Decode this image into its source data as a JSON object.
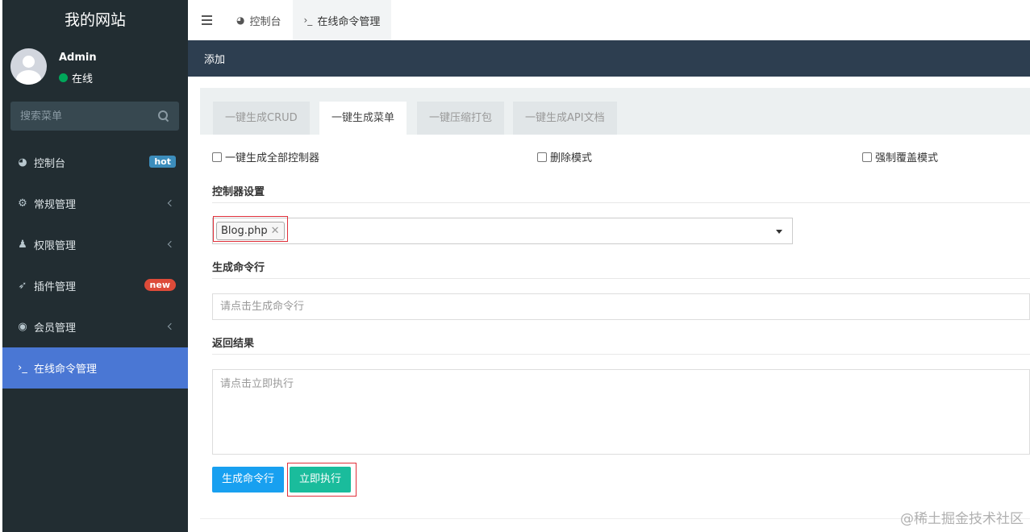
{
  "sidebar": {
    "brand": "我的网站",
    "user": {
      "name": "Admin",
      "status": "在线"
    },
    "search_placeholder": "搜索菜单",
    "items": [
      {
        "label": "控制台",
        "icon": "dashboard-icon",
        "badge": "hot"
      },
      {
        "label": "常规管理",
        "icon": "cogs-icon"
      },
      {
        "label": "权限管理",
        "icon": "group-icon"
      },
      {
        "label": "插件管理",
        "icon": "rocket-icon",
        "badge": "new"
      },
      {
        "label": "会员管理",
        "icon": "user-circle-icon"
      },
      {
        "label": "在线命令管理",
        "icon": "terminal-icon",
        "active": true
      }
    ]
  },
  "navbar": {
    "tabs": [
      {
        "label": "控制台",
        "icon": "dashboard-icon"
      },
      {
        "label": "在线命令管理",
        "icon": "terminal-icon",
        "active": true
      }
    ]
  },
  "header": {
    "title": "添加"
  },
  "content": {
    "tabs": [
      {
        "label": "一键生成CRUD"
      },
      {
        "label": "一键生成菜单",
        "active": true
      },
      {
        "label": "一键压缩打包"
      },
      {
        "label": "一键生成API文档"
      }
    ],
    "checkboxes": [
      {
        "label": "一键生成全部控制器",
        "checked": false
      },
      {
        "label": "删除模式",
        "checked": false
      },
      {
        "label": "强制覆盖模式",
        "checked": false
      }
    ],
    "controller_section": "控制器设置",
    "selected_controller": "Blog.php",
    "command_section": "生成命令行",
    "command_placeholder": "请点击生成命令行",
    "result_section": "返回结果",
    "result_placeholder": "请点击立即执行",
    "generate_button": "生成命令行",
    "execute_button": "立即执行"
  },
  "watermark": "@稀土掘金技术社区",
  "colors": {
    "sidebar_bg": "#222d32",
    "active_menu": "#4a77d4",
    "header_bg": "#2d3e50",
    "primary_button": "#18a0f0",
    "success_button": "#1abc9c",
    "highlight_border": "#e0303a"
  }
}
